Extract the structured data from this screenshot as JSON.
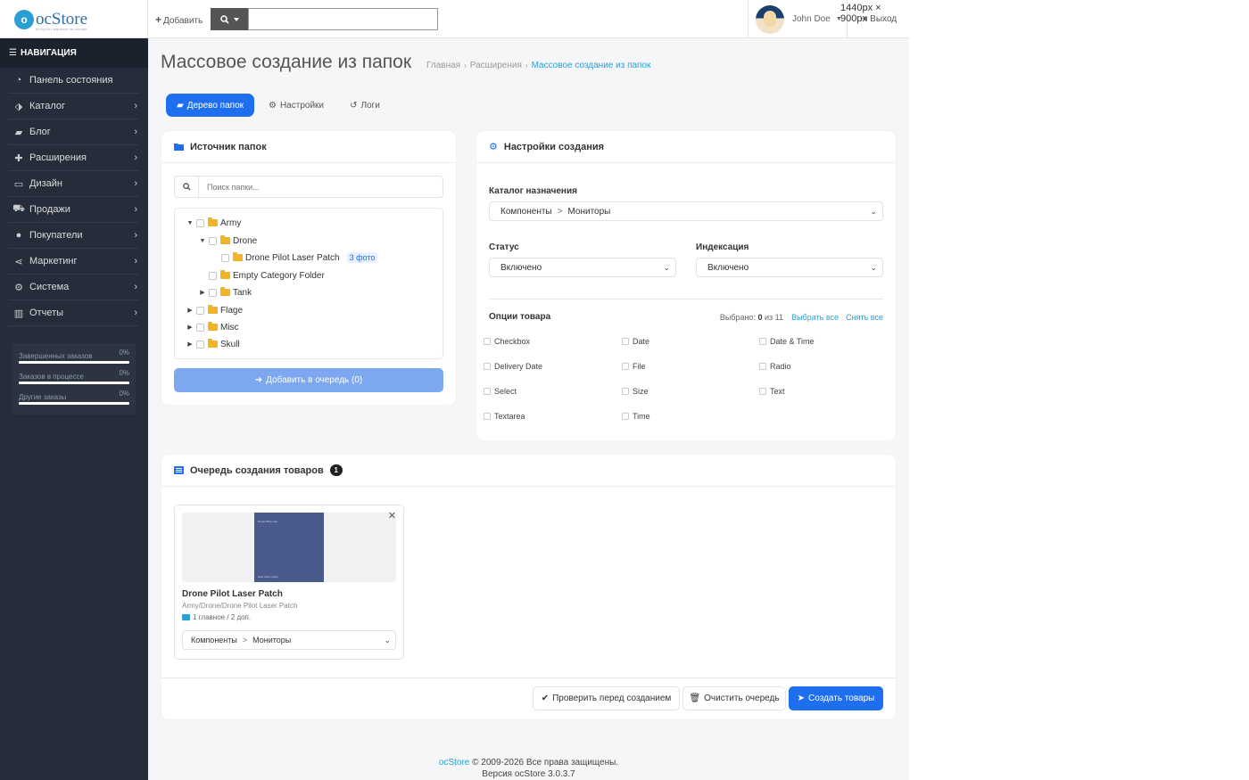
{
  "header": {
    "logo": {
      "mark": "o",
      "text": "ocStore",
      "tagline": "интернет-магазин на основе"
    },
    "add_label": "Добавить",
    "search": {
      "value": ""
    },
    "user": {
      "name": "John Doe"
    },
    "logout_label": "Выход",
    "size_readout": "1440px × 900px"
  },
  "sidebar": {
    "title": "НАВИГАЦИЯ",
    "items": [
      {
        "label": "Панель состояния",
        "icon": "dashboard-icon"
      },
      {
        "label": "Каталог",
        "icon": "tags-icon"
      },
      {
        "label": "Блог",
        "icon": "book-icon"
      },
      {
        "label": "Расширения",
        "icon": "puzzle-icon"
      },
      {
        "label": "Дизайн",
        "icon": "monitor-icon"
      },
      {
        "label": "Продажи",
        "icon": "cart-icon"
      },
      {
        "label": "Покупатели",
        "icon": "user-icon"
      },
      {
        "label": "Маркетинг",
        "icon": "share-icon"
      },
      {
        "label": "Система",
        "icon": "gear-icon"
      },
      {
        "label": "Отчеты",
        "icon": "bar-chart-icon"
      }
    ],
    "stats": [
      {
        "label": "Завершенных заказов",
        "value": "0%"
      },
      {
        "label": "Заказов в процессе",
        "value": "0%"
      },
      {
        "label": "Другие заказы",
        "value": "0%"
      }
    ]
  },
  "page": {
    "title": "Массовое создание из папок",
    "breadcrumb": [
      "Главная",
      "Расширения",
      "Массовое создание из папок"
    ]
  },
  "tabs": [
    {
      "label": "Дерево папок",
      "active": true
    },
    {
      "label": "Настройки",
      "active": false
    },
    {
      "label": "Логи",
      "active": false
    }
  ],
  "source_panel": {
    "title": "Источник папок",
    "search_placeholder": "Поиск папки...",
    "tree": [
      {
        "label": "Army",
        "level": 0,
        "arrow": "down"
      },
      {
        "label": "Drone",
        "level": 1,
        "arrow": "down"
      },
      {
        "label": "Drone Pilot Laser Patch",
        "level": 2,
        "arrow": "",
        "badge": "3 фото"
      },
      {
        "label": "Empty Category Folder",
        "level": 1,
        "arrow": ""
      },
      {
        "label": "Tank",
        "level": 1,
        "arrow": "right"
      },
      {
        "label": "Flage",
        "level": 0,
        "arrow": "right"
      },
      {
        "label": "Misc",
        "level": 0,
        "arrow": "right"
      },
      {
        "label": "Skull",
        "level": 0,
        "arrow": "right"
      }
    ],
    "add_button": "Добавить в очередь (0)"
  },
  "settings_panel": {
    "title": "Настройки создания",
    "catalog_label": "Каталог назначения",
    "catalog_value": {
      "parent": "Компоненты",
      "sep": ">",
      "child": "Мониторы"
    },
    "status_label": "Статус",
    "status_value": "Включено",
    "index_label": "Индексация",
    "index_value": "Включено",
    "options_label": "Опции товара",
    "selected_prefix": "Выбрано:",
    "selected_count": "0",
    "selected_suffix": "из 11",
    "select_all": "Выбрать все",
    "clear_all": "Снять все",
    "options": [
      "Checkbox",
      "Date",
      "Date & Time",
      "Delivery Date",
      "File",
      "Radio",
      "Select",
      "Size",
      "Text",
      "Textarea",
      "Time"
    ]
  },
  "queue_panel": {
    "title": "Очередь создания товаров",
    "count": "1",
    "card": {
      "image_caption_top": "Drone Pilot Lase",
      "image_caption_bottom": "laser fabric patch",
      "name": "Drone Pilot Laser Patch",
      "path": "Army/Drone/Drone Pilot Laser Patch",
      "photos": "1 главное / 2 доп.",
      "category": {
        "parent": "Компоненты",
        "sep": ">",
        "child": "Мониторы"
      }
    },
    "buttons": {
      "check": "Проверить перед созданием",
      "clear": "Очистить очередь",
      "create": "Создать товары"
    }
  },
  "footer": {
    "brand": "ocStore",
    "copyright": "© 2009-2026 Все права защищены.",
    "version": "Версия ocStore 3.0.3.7"
  },
  "colors": {
    "primary": "#1e6ff0",
    "sidebar": "#252d3a",
    "link": "#2a9fd6",
    "folder": "#f0b429"
  }
}
